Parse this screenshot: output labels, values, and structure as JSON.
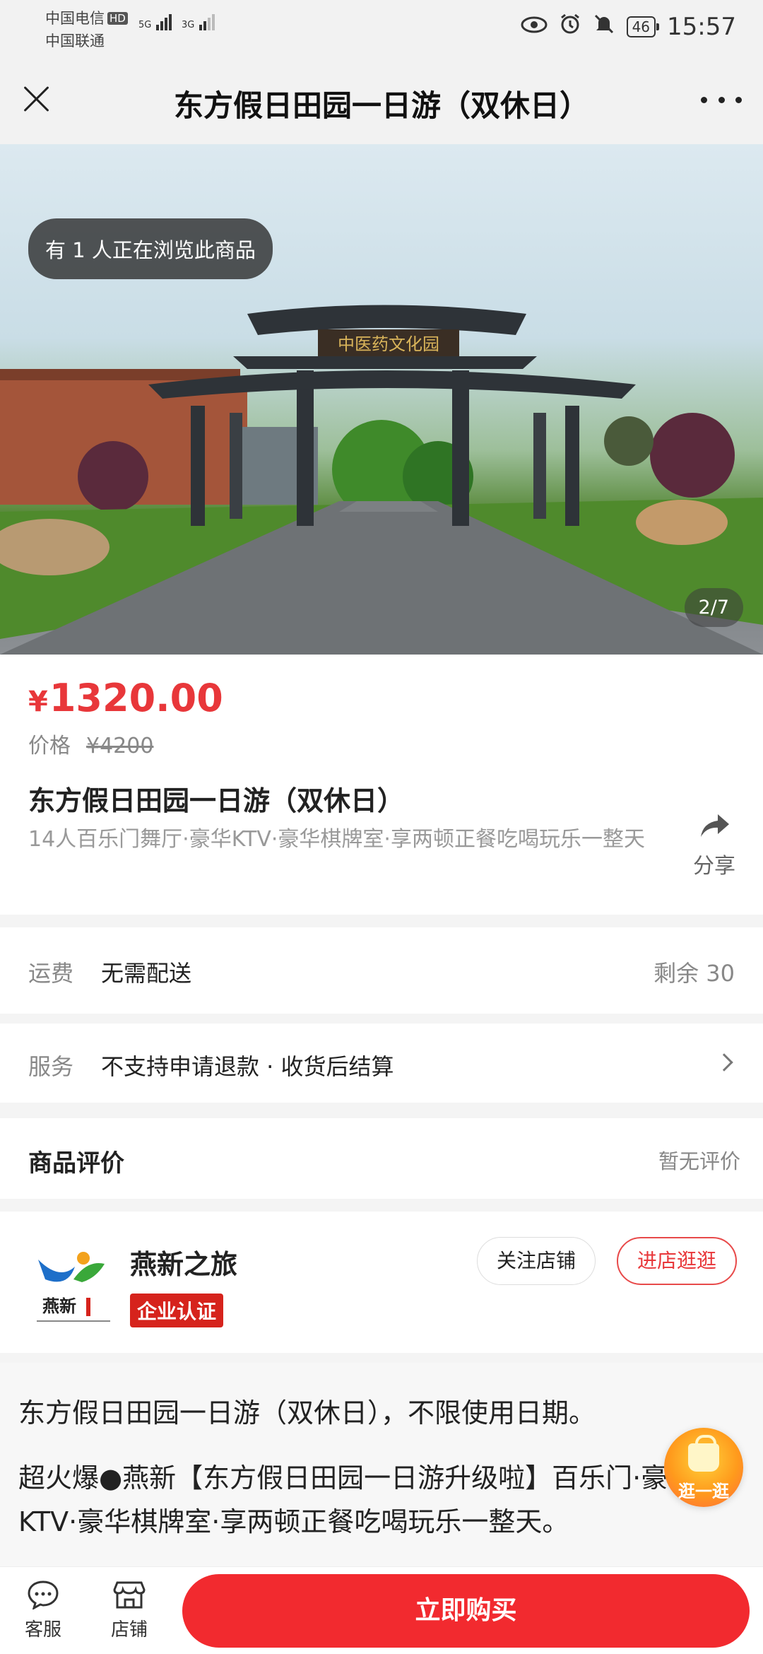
{
  "status_bar": {
    "carrier_1": "中国电信",
    "carrier_1_badge": "HD",
    "carrier_2": "中国联通",
    "signal_1": "5G",
    "signal_2": "3G",
    "battery": "46",
    "time": "15:57"
  },
  "header": {
    "title": "东方假日田园一日游（双休日）"
  },
  "hero": {
    "viewers_text": "有 1 人正在浏览此商品",
    "page_counter": "2/7",
    "gate_sign": "中医药文化园"
  },
  "product": {
    "currency": "¥",
    "price": "1320.00",
    "original_label": "价格",
    "original_price": "¥4200",
    "name": "东方假日田园一日游（双休日）",
    "description": "14人百乐门舞厅·豪华KTV·豪华棋牌室·享两顿正餐吃喝玩乐一整天",
    "share_label": "分享"
  },
  "shipping": {
    "label": "运费",
    "value": "无需配送",
    "stock": "剩余 30"
  },
  "service": {
    "label": "服务",
    "value": "不支持申请退款 · 收货后结算"
  },
  "reviews": {
    "title": "商品评价",
    "status": "暂无评价"
  },
  "shop": {
    "name": "燕新之旅",
    "logo_text": "燕新",
    "badge": "企业认证",
    "follow_label": "关注店铺",
    "visit_label": "进店逛逛"
  },
  "detail": {
    "line_1": "东方假日田园一日游（双休日），不限使用日期。",
    "line_2": "超火爆●燕新【东方假日田园一日游升级啦】百乐门·豪华KTV·豪华棋牌室·享两顿正餐吃喝玩乐一整天。"
  },
  "float_button": {
    "label": "逛一逛"
  },
  "bottom_bar": {
    "service_label": "客服",
    "shop_label": "店铺",
    "buy_label": "立即购买"
  },
  "colors": {
    "price": "#e8373a",
    "buy_button": "#f22a2f",
    "verified_badge": "#d6231c"
  }
}
